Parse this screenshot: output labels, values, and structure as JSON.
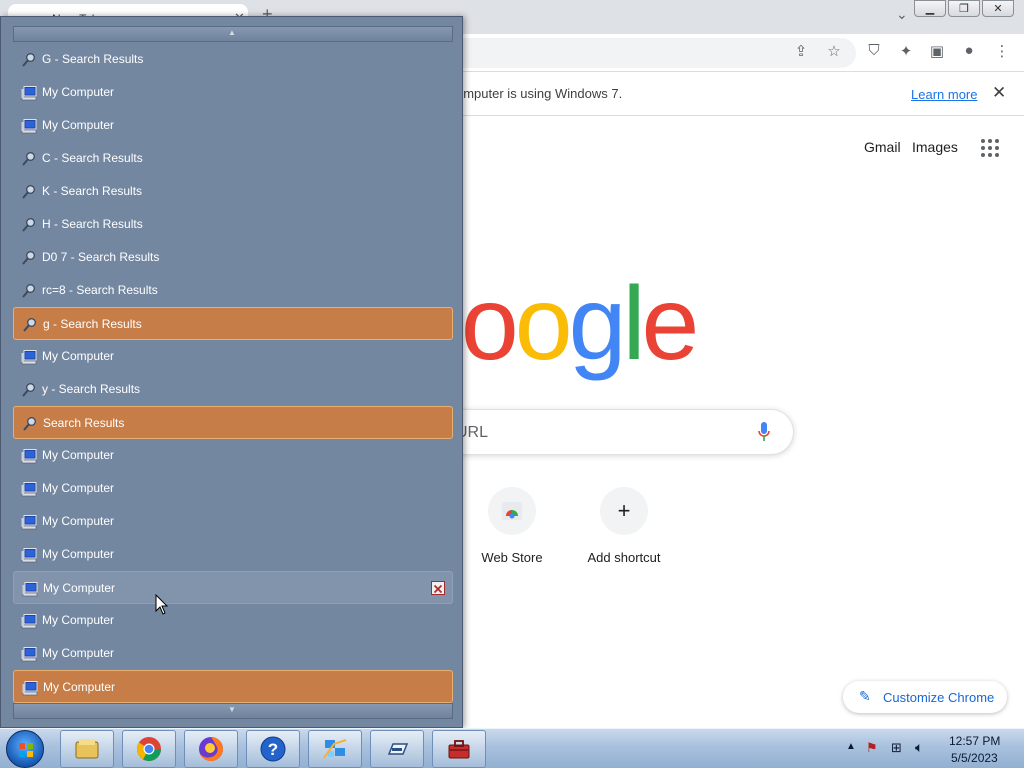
{
  "browser": {
    "tab_title": "New Tab",
    "infobar_text": "omputer is using Windows 7.",
    "infobar_link": "Learn more",
    "header_links": [
      "Gmail",
      "Images"
    ],
    "search_placeholder": "URL",
    "shortcuts": [
      {
        "label": "Web Store"
      },
      {
        "label": "Add shortcut"
      }
    ],
    "customize_label": "Customize Chrome"
  },
  "history_panel": {
    "items": [
      {
        "label": "G - Search Results",
        "icon": "search-icon",
        "state": "normal"
      },
      {
        "label": "My Computer",
        "icon": "computer-icon",
        "state": "normal"
      },
      {
        "label": "My Computer",
        "icon": "computer-icon",
        "state": "normal"
      },
      {
        "label": "C - Search Results",
        "icon": "search-icon",
        "state": "normal"
      },
      {
        "label": "K - Search Results",
        "icon": "search-icon",
        "state": "normal"
      },
      {
        "label": "H - Search Results",
        "icon": "search-icon",
        "state": "normal"
      },
      {
        "label": "D0 7 - Search Results",
        "icon": "search-icon",
        "state": "normal"
      },
      {
        "label": "rc=8 - Search Results",
        "icon": "search-icon",
        "state": "normal"
      },
      {
        "label": "g - Search Results",
        "icon": "search-icon",
        "state": "highlighted"
      },
      {
        "label": "My Computer",
        "icon": "computer-icon",
        "state": "normal"
      },
      {
        "label": "y - Search Results",
        "icon": "search-icon",
        "state": "normal"
      },
      {
        "label": "Search Results",
        "icon": "search-icon",
        "state": "highlighted"
      },
      {
        "label": "My Computer",
        "icon": "computer-icon",
        "state": "normal"
      },
      {
        "label": "My Computer",
        "icon": "computer-icon",
        "state": "normal"
      },
      {
        "label": "My Computer",
        "icon": "computer-icon",
        "state": "normal"
      },
      {
        "label": "My Computer",
        "icon": "computer-icon",
        "state": "normal"
      },
      {
        "label": "My Computer",
        "icon": "computer-icon",
        "state": "hover"
      },
      {
        "label": "My Computer",
        "icon": "computer-icon",
        "state": "normal"
      },
      {
        "label": "My Computer",
        "icon": "computer-icon",
        "state": "normal"
      },
      {
        "label": "My Computer",
        "icon": "computer-icon",
        "state": "highlighted"
      }
    ]
  },
  "taskbar": {
    "apps": [
      "windows-explorer-icon",
      "chrome-icon",
      "firefox-icon",
      "help-icon",
      "network-app-icon",
      "drive-app-icon",
      "toolbox-icon"
    ],
    "time": "12:57 PM",
    "date": "5/5/2023"
  },
  "colors": {
    "panel_bg": "#7487a1",
    "highlight": "#c77d48",
    "link_blue": "#1a73e8"
  }
}
